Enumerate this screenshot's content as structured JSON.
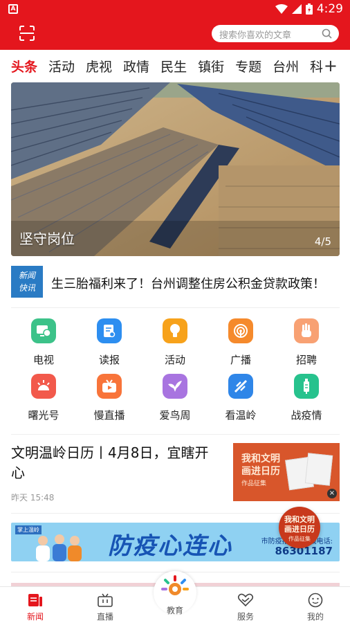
{
  "status": {
    "time": "4:29",
    "app_icon": "A"
  },
  "search": {
    "placeholder": "搜索你喜欢的文章"
  },
  "tabs": [
    "头条",
    "活动",
    "虎视",
    "政情",
    "民生",
    "镇街",
    "专题",
    "台州",
    "科"
  ],
  "banner": {
    "caption": "坚守岗位",
    "index": "4/5"
  },
  "flash": {
    "logo_line1": "新闻",
    "logo_line2": "快讯",
    "text": "生三胎福利来了！台州调整住房公积金贷款政策！"
  },
  "services": [
    {
      "label": "电视",
      "icon": "tv-icon",
      "color": "#3cc289"
    },
    {
      "label": "读报",
      "icon": "newspaper-icon",
      "color": "#2d8ef0"
    },
    {
      "label": "活动",
      "icon": "bulb-icon",
      "color": "#f7a21b"
    },
    {
      "label": "广播",
      "icon": "radio-icon",
      "color": "#f58a2c"
    },
    {
      "label": "招聘",
      "icon": "hand-icon",
      "color": "#f8a173"
    },
    {
      "label": "曙光号",
      "icon": "sunrise-icon",
      "color": "#f2594b"
    },
    {
      "label": "慢直播",
      "icon": "live-icon",
      "color": "#f8743a"
    },
    {
      "label": "爱鸟周",
      "icon": "bird-icon",
      "color": "#a874e0"
    },
    {
      "label": "看温岭",
      "icon": "compass-icon",
      "color": "#2f86e8"
    },
    {
      "label": "战疫情",
      "icon": "syringe-icon",
      "color": "#27c28d"
    }
  ],
  "article": {
    "title": "文明温岭日历丨4月8日，宜瞎开心",
    "time": "昨天 15:48",
    "thumb_line1": "我和文明",
    "thumb_line2": "画进日历",
    "thumb_line3": "作品征集"
  },
  "ad": {
    "brand": "掌上温岭",
    "headline": "防疫心连心",
    "hotline_label": "市防疫指挥部热线电话:",
    "hotline": "86301187"
  },
  "floating_badge": {
    "line1": "我和文明",
    "line2": "画进日历",
    "line3": "作品征集"
  },
  "tabbar": {
    "news": "新闻",
    "live": "直播",
    "edu": "教育",
    "service": "服务",
    "mine": "我的"
  }
}
